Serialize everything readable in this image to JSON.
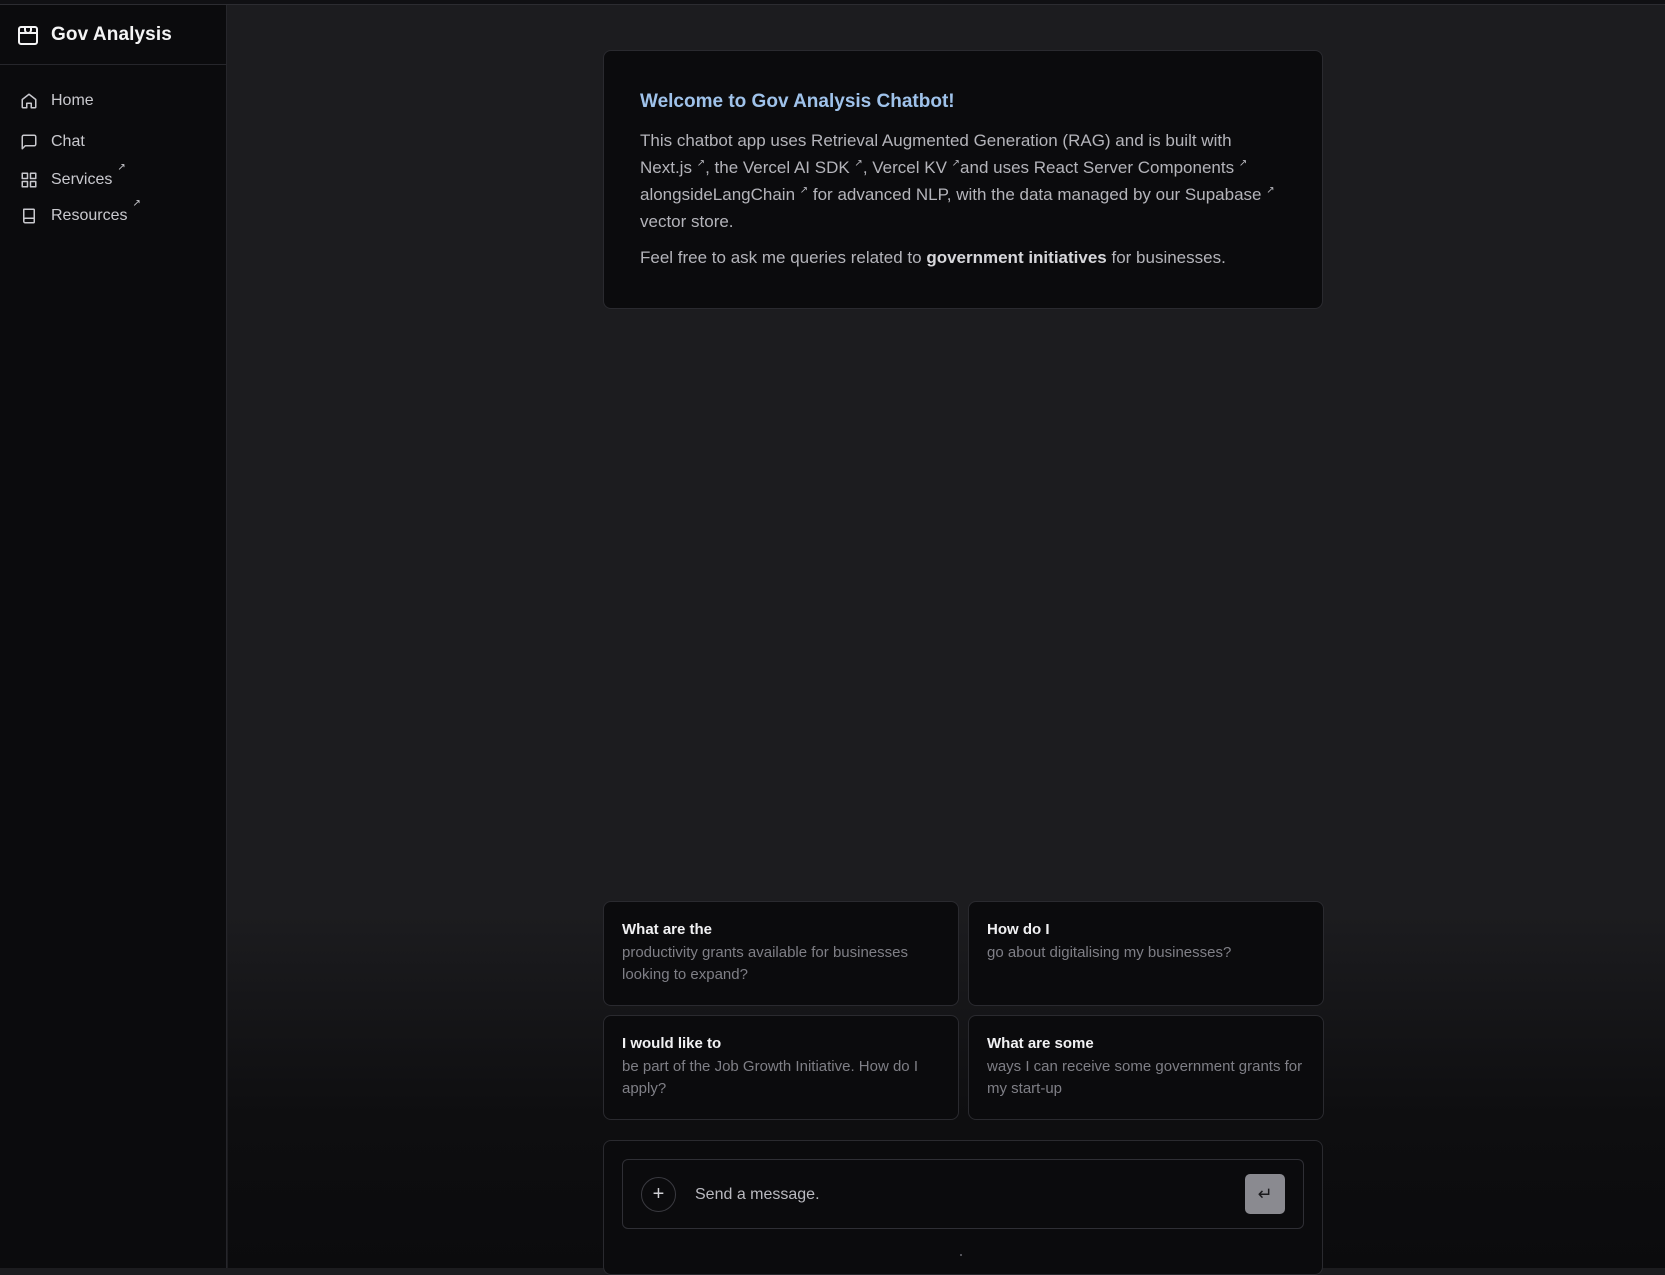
{
  "sidebar": {
    "brand": "Gov Analysis",
    "items": [
      {
        "label": "Home",
        "icon": "home-icon",
        "external": false
      },
      {
        "label": "Chat",
        "icon": "chat-icon",
        "external": false
      },
      {
        "label": "Services",
        "icon": "grid-icon",
        "external": true
      },
      {
        "label": "Resources",
        "icon": "book-icon",
        "external": true
      }
    ],
    "external_marker": "↗"
  },
  "welcome": {
    "title": "Welcome to Gov Analysis Chatbot!",
    "p1_a": "This chatbot app uses Retrieval Augmented Generation (RAG) and is built with ",
    "link_nextjs": "Next.js",
    "p1_b": ", the ",
    "link_ai_sdk": "Vercel AI SDK",
    "p1_c": ", ",
    "link_kv": "Vercel KV",
    "p1_d": "and uses ",
    "link_rsc": "React Server Components",
    "p1_e": " alongside",
    "link_langchain": "LangChain",
    "p1_f": " for advanced NLP, with the data managed by our ",
    "link_supabase": "Supabase",
    "p1_g": " vector store.",
    "p2_a": "Feel free to ask me queries related to ",
    "p2_bold": "government initiatives",
    "p2_b": " for businesses.",
    "ext_marker": "↗"
  },
  "suggestions": [
    {
      "heading": "What are the",
      "text": "productivity grants available for businesses looking to expand?"
    },
    {
      "heading": "How do I",
      "text": "go about digitalising my businesses?"
    },
    {
      "heading": "I would like to",
      "text": "be part of the Job Growth Initiative. How do I apply?"
    },
    {
      "heading": "What are some",
      "text": "ways I can receive some government grants for my start-up"
    }
  ],
  "composer": {
    "placeholder": "Send a message.",
    "plus_label": "+",
    "send_label": "↵"
  }
}
